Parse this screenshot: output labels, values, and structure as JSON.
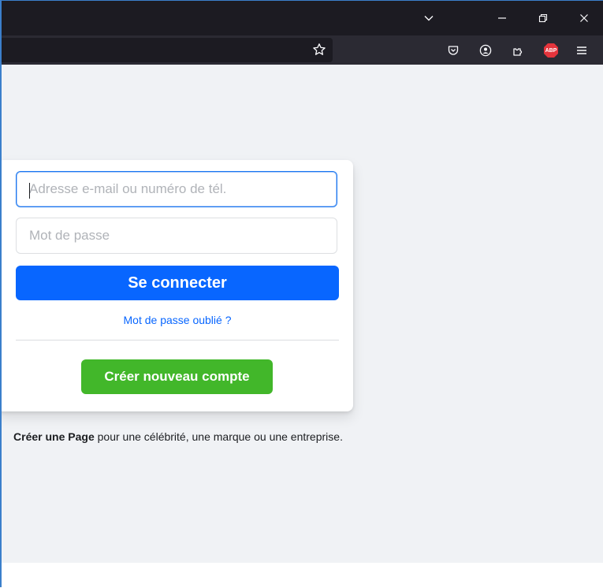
{
  "browser": {
    "titlebar_icons": [
      "chevron-down-icon",
      "minimize-icon",
      "restore-icon",
      "close-icon"
    ],
    "toolbar_icons": [
      "bookmark-star-icon",
      "pocket-icon",
      "account-icon",
      "extensions-icon",
      "adblock-plus-icon",
      "menu-icon"
    ],
    "adblock_label": "ABP",
    "colors": {
      "titlebar": "#1c1b22",
      "toolbar": "#2b2a33",
      "adblock": "#e4343c"
    }
  },
  "login": {
    "email_placeholder": "Adresse e-mail ou numéro de tél.",
    "password_placeholder": "Mot de passe",
    "login_label": "Se connecter",
    "forgot_label": "Mot de passe oublié ?",
    "create_label": "Créer nouveau compte"
  },
  "page_note": {
    "link_label": "Créer une Page",
    "text": " pour une célébrité, une marque ou une entreprise."
  },
  "colors": {
    "primary": "#0866ff",
    "create": "#42b72a",
    "background": "#f0f2f5"
  }
}
